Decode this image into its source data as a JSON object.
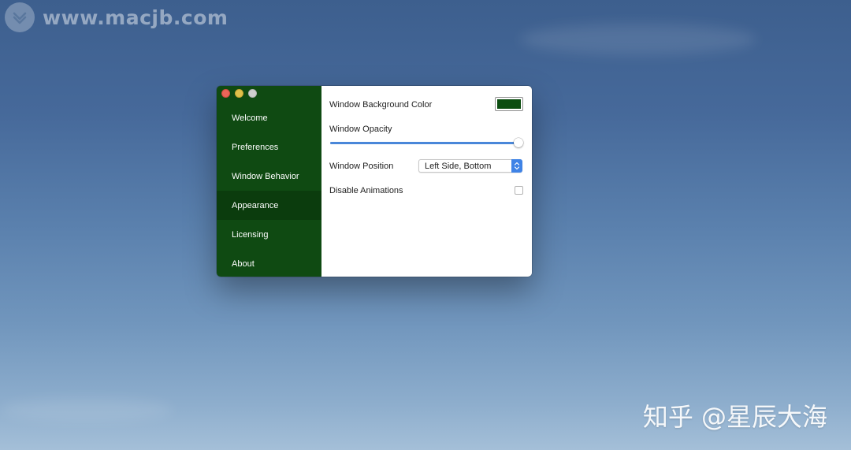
{
  "watermark": {
    "url": "www.macjb.com",
    "credit": "知乎 @星辰大海"
  },
  "window": {
    "sidebar": {
      "items": [
        {
          "label": "Welcome",
          "active": false
        },
        {
          "label": "Preferences",
          "active": false
        },
        {
          "label": "Window Behavior",
          "active": false
        },
        {
          "label": "Appearance",
          "active": true
        },
        {
          "label": "Licensing",
          "active": false
        },
        {
          "label": "About",
          "active": false
        }
      ]
    },
    "appearance": {
      "background_color_label": "Window Background Color",
      "background_color_value": "#0b4d10",
      "opacity_label": "Window Opacity",
      "opacity_value": 0.98,
      "position_label": "Window Position",
      "position_value": "Left Side, Bottom",
      "animations_label": "Disable Animations",
      "animations_checked": false
    }
  },
  "colors": {
    "sidebar_bg": "#0f4a12",
    "sidebar_active": "#0b3c0d",
    "accent": "#3f83e6"
  }
}
